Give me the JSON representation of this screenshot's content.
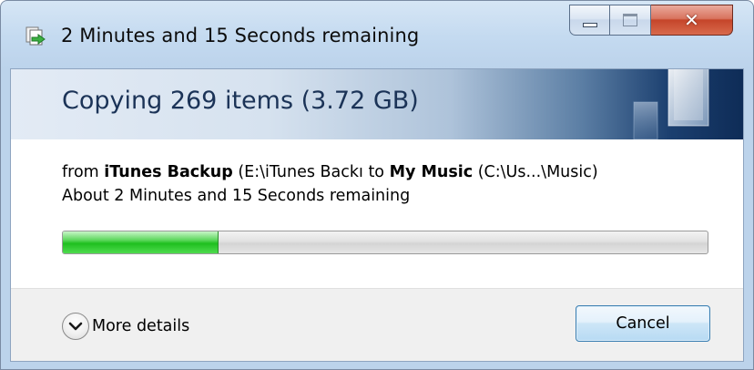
{
  "window": {
    "title": "2 Minutes and 15 Seconds remaining"
  },
  "header": {
    "title": "Copying 269 items (3.72 GB)"
  },
  "details": {
    "from_prefix": "from ",
    "source_name": "iTunes Backup",
    "source_path": " (E:\\iTunes Backı",
    "to_word": " to ",
    "dest_name": "My Music",
    "dest_path": " (C:\\Us...\\Music)",
    "remaining": "About 2 Minutes and 15 Seconds remaining"
  },
  "progress": {
    "fraction": 0.24
  },
  "footer": {
    "more_details_label": "More details",
    "cancel_label": "Cancel"
  },
  "icons": {
    "title": "copy-file-arrow-icon",
    "chevron": "chevron-down-icon"
  },
  "colors": {
    "progress_fill": "#1fbf1f",
    "header_dark": "#0e2c57",
    "close_button": "#c5452a"
  }
}
